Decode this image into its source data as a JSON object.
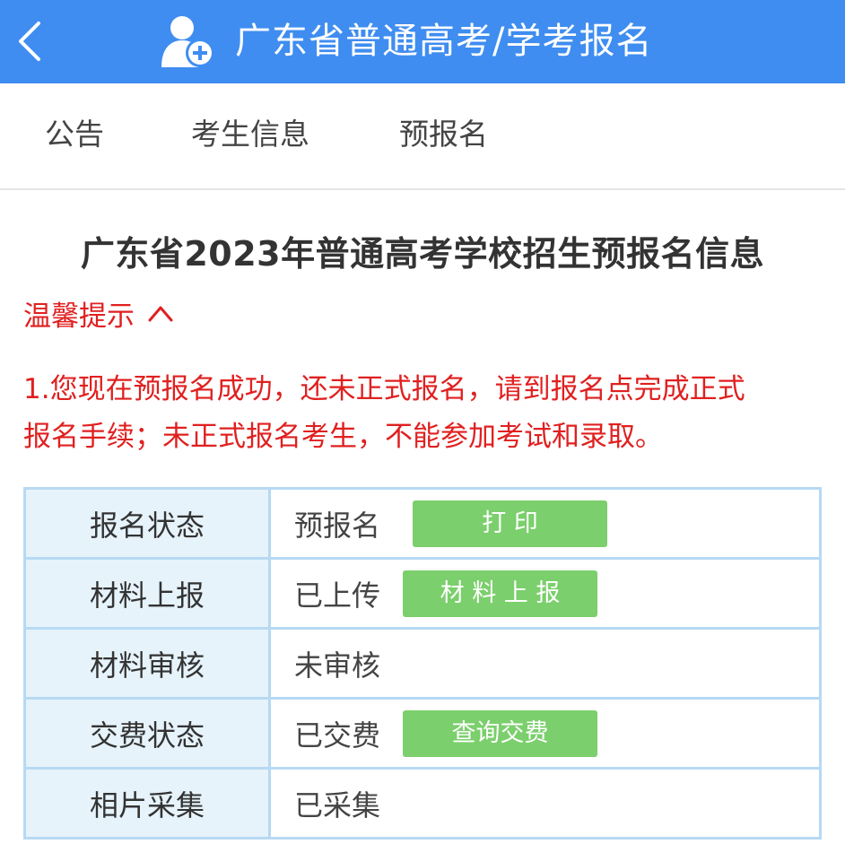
{
  "header": {
    "title": "广东省普通高考/学考报名",
    "back_icon": "chevron-left-icon",
    "app_icon": "user-add-icon",
    "background": "#3f8df0"
  },
  "tabs": [
    {
      "label": "公告"
    },
    {
      "label": "考生信息"
    },
    {
      "label": "预报名"
    }
  ],
  "page": {
    "title": "广东省2023年普通高考学校招生预报名信息"
  },
  "tip": {
    "toggle_label": "温馨提示",
    "toggle_icon": "chevron-up-icon",
    "line1": "1.您现在预报名成功，还未正式报名，请到报名点完成正式",
    "line2": "报名手续；未正式报名考生，不能参加考试和录取。",
    "color": "#e02020"
  },
  "table": {
    "rows": [
      {
        "label": "报名状态",
        "value": "预报名",
        "button": "打 印"
      },
      {
        "label": "材料上报",
        "value": "已上传",
        "button": "材 料 上 报"
      },
      {
        "label": "材料审核",
        "value": "未审核"
      },
      {
        "label": "交费状态",
        "value": "已交费",
        "button": "查询交费"
      },
      {
        "label": "相片采集",
        "value": "已采集"
      }
    ],
    "button_color": "#7bcf6c",
    "label_bg": "#e6f3fb",
    "border_color": "#b7d9f3"
  }
}
